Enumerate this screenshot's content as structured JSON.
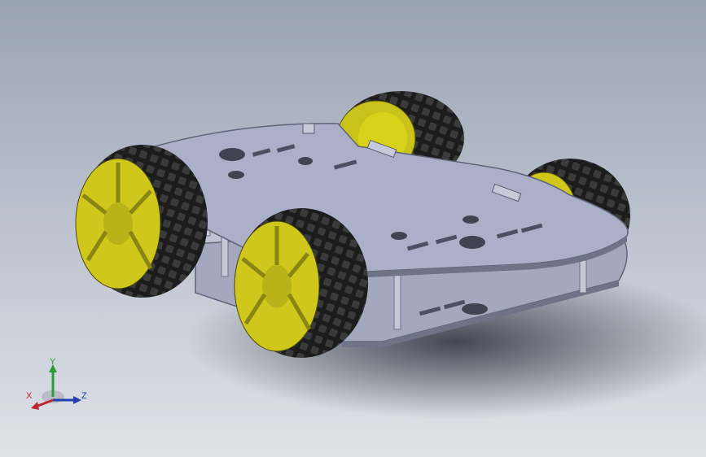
{
  "viewport": {
    "background_top": "#9aa3b4",
    "background_bottom": "#dfe2e8"
  },
  "model": {
    "plate_color": "#a9aec6",
    "plate_edge": "#6e7388",
    "tire_color": "#2a2a2a",
    "hub_color": "#d9d21a",
    "standoff_color": "#c4c8d8"
  },
  "triad": {
    "x_label": "X",
    "y_label": "Y",
    "z_label": "Z",
    "x_color": "#c0262c",
    "y_color": "#2a9a3a",
    "z_color": "#1f3fae"
  }
}
